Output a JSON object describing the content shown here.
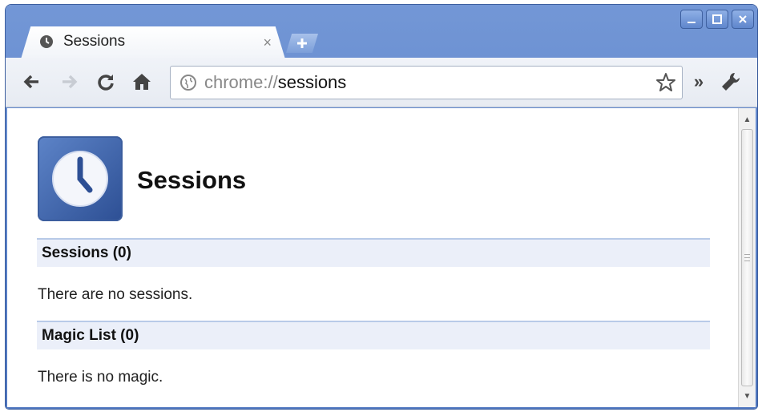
{
  "window": {
    "controls": [
      "minimize",
      "maximize",
      "close"
    ]
  },
  "tab": {
    "title": "Sessions",
    "close_glyph": "×"
  },
  "toolbar": {
    "url_scheme": "chrome://",
    "url_path": "sessions",
    "overflow_glyph": "»"
  },
  "page": {
    "title": "Sessions",
    "sections": [
      {
        "heading": "Sessions (0)",
        "body": "There are no sessions."
      },
      {
        "heading": "Magic List (0)",
        "body": "There is no magic."
      }
    ]
  },
  "colors": {
    "frame": "#5b82c9",
    "section_bg": "#ebeff9",
    "section_border": "#b8cae8",
    "logo": "#3c5e9e"
  },
  "icons": [
    "clock-icon",
    "new-tab-plus-icon",
    "back-arrow-icon",
    "forward-arrow-icon",
    "reload-icon",
    "home-icon",
    "globe-icon",
    "star-icon",
    "wrench-icon"
  ]
}
